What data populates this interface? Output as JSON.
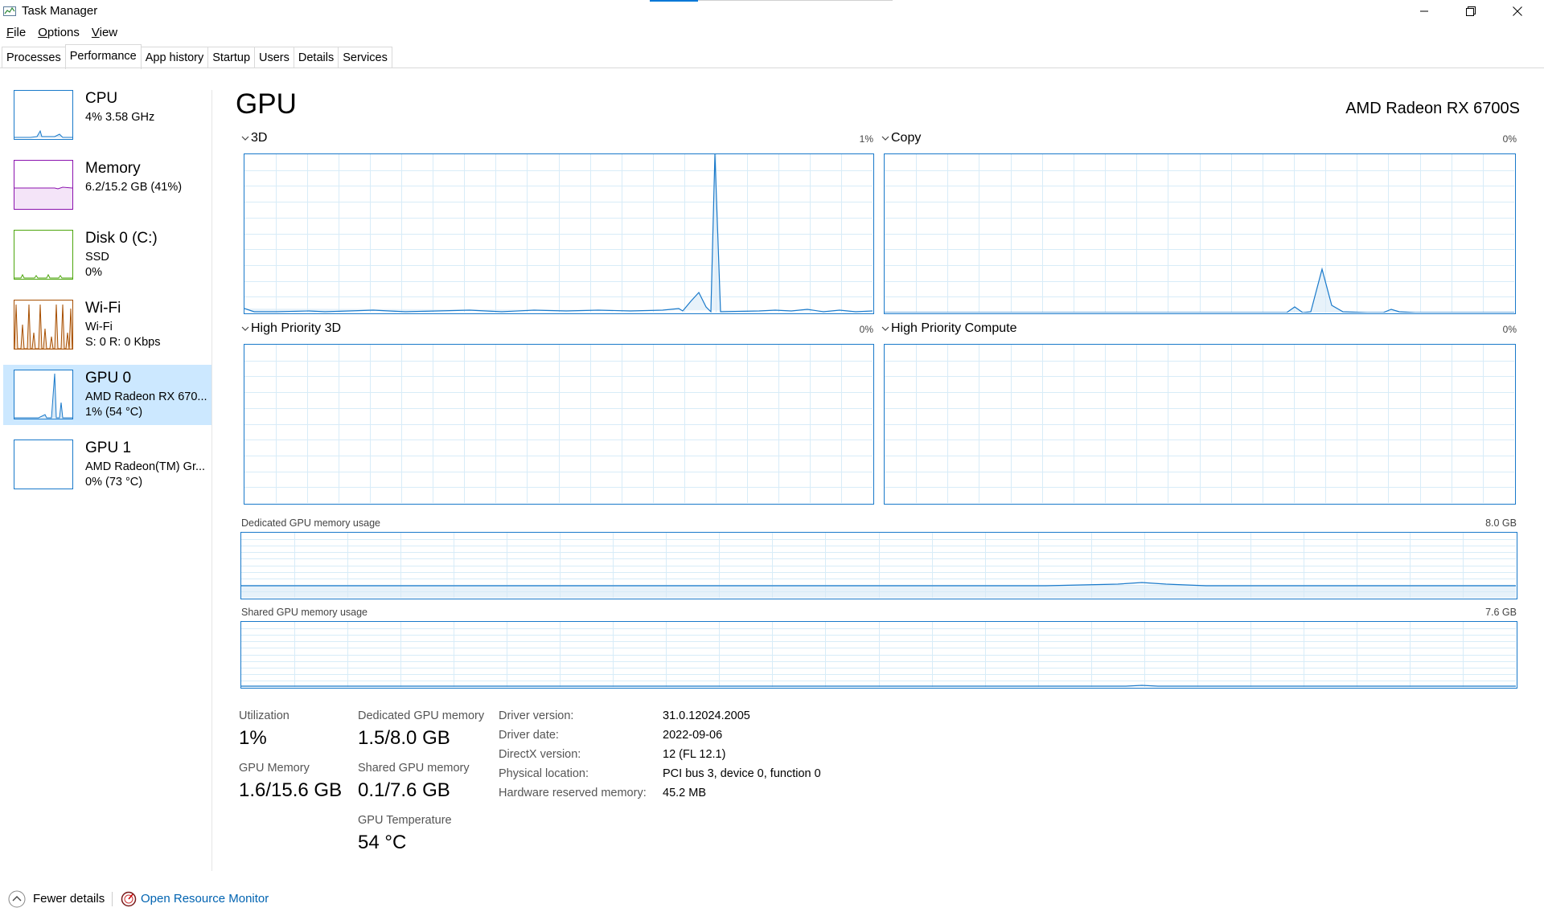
{
  "window": {
    "title": "Task Manager"
  },
  "menu": [
    {
      "label": "File",
      "u": "F",
      "rest": "ile"
    },
    {
      "label": "Options",
      "u": "O",
      "rest": "ptions"
    },
    {
      "label": "View",
      "u": "V",
      "rest": "iew"
    }
  ],
  "tabs": [
    "Processes",
    "Performance",
    "App history",
    "Startup",
    "Users",
    "Details",
    "Services"
  ],
  "active_tab": "Performance",
  "sidebar": {
    "items": [
      {
        "name": "CPU",
        "sub1": "4%  3.58 GHz",
        "sub2": "",
        "color": "#1979ca"
      },
      {
        "name": "Memory",
        "sub1": "6.2/15.2 GB (41%)",
        "sub2": "",
        "color": "#8b12ae"
      },
      {
        "name": "Disk 0 (C:)",
        "sub1": "SSD",
        "sub2": "0%",
        "color": "#4da60c"
      },
      {
        "name": "Wi-Fi",
        "sub1": "Wi-Fi",
        "sub2": "S: 0  R: 0 Kbps",
        "color": "#a74f01"
      },
      {
        "name": "GPU 0",
        "sub1": "AMD Radeon RX 670...",
        "sub2": "1%  (54 °C)",
        "color": "#1979ca",
        "selected": true
      },
      {
        "name": "GPU 1",
        "sub1": "AMD Radeon(TM) Gr...",
        "sub2": "0%  (73 °C)",
        "color": "#1979ca"
      }
    ]
  },
  "main": {
    "title": "GPU",
    "gpu_name": "AMD Radeon RX 6700S",
    "engines": [
      {
        "label": "3D",
        "pct": "1%"
      },
      {
        "label": "Copy",
        "pct": "0%"
      },
      {
        "label": "High Priority 3D",
        "pct": "0%"
      },
      {
        "label": "High Priority Compute",
        "pct": "0%"
      }
    ],
    "dedicated_mem": {
      "label": "Dedicated GPU memory usage",
      "max": "8.0 GB"
    },
    "shared_mem": {
      "label": "Shared GPU memory usage",
      "max": "7.6 GB"
    }
  },
  "stats": {
    "utilization_label": "Utilization",
    "utilization": "1%",
    "gpu_memory_label": "GPU Memory",
    "gpu_memory": "1.6/15.6 GB",
    "dedicated_label": "Dedicated GPU memory",
    "dedicated": "1.5/8.0 GB",
    "shared_label": "Shared GPU memory",
    "shared": "0.1/7.6 GB",
    "temp_label": "GPU Temperature",
    "temp": "54 °C"
  },
  "info": [
    {
      "label": "Driver version:",
      "value": "31.0.12024.2005"
    },
    {
      "label": "Driver date:",
      "value": "2022-09-06"
    },
    {
      "label": "DirectX version:",
      "value": "12 (FL 12.1)"
    },
    {
      "label": "Physical location:",
      "value": "PCI bus 3, device 0, function 0"
    },
    {
      "label": "Hardware reserved memory:",
      "value": "45.2 MB"
    }
  ],
  "footer": {
    "fewer": "Fewer details",
    "fewer_u": "d",
    "monitor": "Open Resource Monitor"
  },
  "colors": {
    "accent": "#1979ca",
    "selected_bg": "#cce8ff",
    "grid": "#d8ecf8"
  }
}
